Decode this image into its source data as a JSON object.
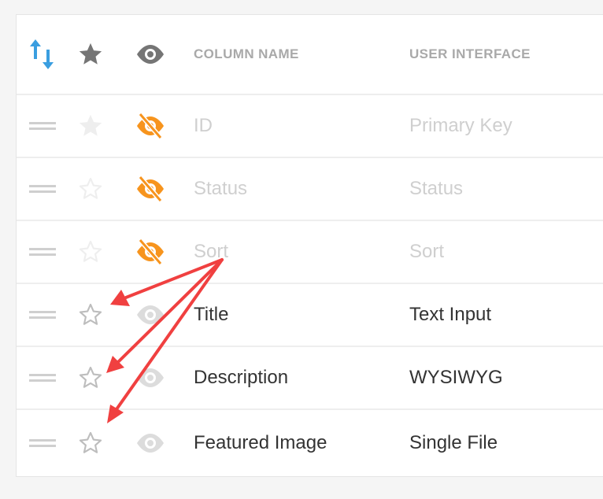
{
  "header": {
    "column_name_label": "COLUMN NAME",
    "user_interface_label": "USER INTERFACE"
  },
  "rows": [
    {
      "name": "ID",
      "interface": "Primary Key",
      "muted": true,
      "star": "filled-light",
      "visibility": "hidden"
    },
    {
      "name": "Status",
      "interface": "Status",
      "muted": true,
      "star": "outline-light",
      "visibility": "hidden"
    },
    {
      "name": "Sort",
      "interface": "Sort",
      "muted": true,
      "star": "outline-light",
      "visibility": "hidden"
    },
    {
      "name": "Title",
      "interface": "Text Input",
      "muted": false,
      "star": "outline",
      "visibility": "visible"
    },
    {
      "name": "Description",
      "interface": "WYSIWYG",
      "muted": false,
      "star": "outline",
      "visibility": "visible"
    },
    {
      "name": "Featured Image",
      "interface": "Single File",
      "muted": false,
      "star": "outline",
      "visibility": "visible"
    }
  ],
  "colors": {
    "sort_icon": "#3a9ee0",
    "hidden_eye": "#f7941d",
    "annotation_arrow": "#f04040"
  }
}
